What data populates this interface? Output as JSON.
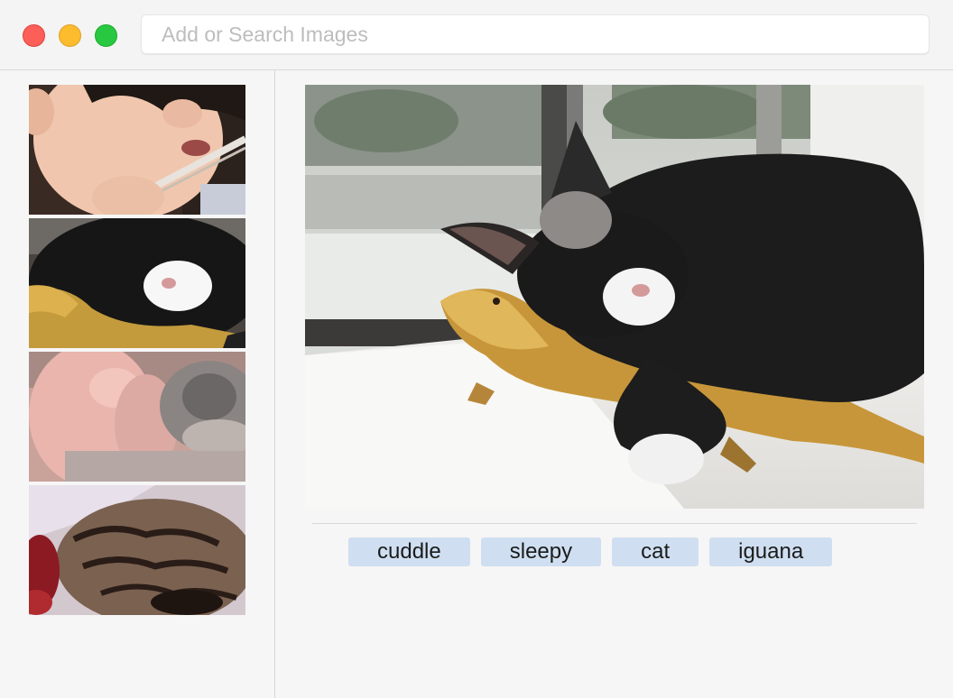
{
  "search": {
    "placeholder": "Add or Search Images",
    "value": ""
  },
  "window_controls": {
    "close": {
      "icon": "close-dot-icon",
      "color": "#fc5f57"
    },
    "minimize": {
      "icon": "minimize-dot-icon",
      "color": "#fdbc2e"
    },
    "zoom": {
      "icon": "zoom-dot-icon",
      "color": "#28c840"
    }
  },
  "sidebar": {
    "thumbnails": [
      {
        "subject": "person-eating-with-chopsticks"
      },
      {
        "subject": "cat-cuddling-iguana"
      },
      {
        "subject": "baby-with-kitten"
      },
      {
        "subject": "tabby-kitten-closeup"
      }
    ]
  },
  "main": {
    "image_subject": "black-and-white-cat-sleeping-on-iguana-by-window",
    "tags": [
      "cuddle",
      "sleepy",
      "cat",
      "iguana"
    ],
    "tag_color": "#cfdff1"
  }
}
